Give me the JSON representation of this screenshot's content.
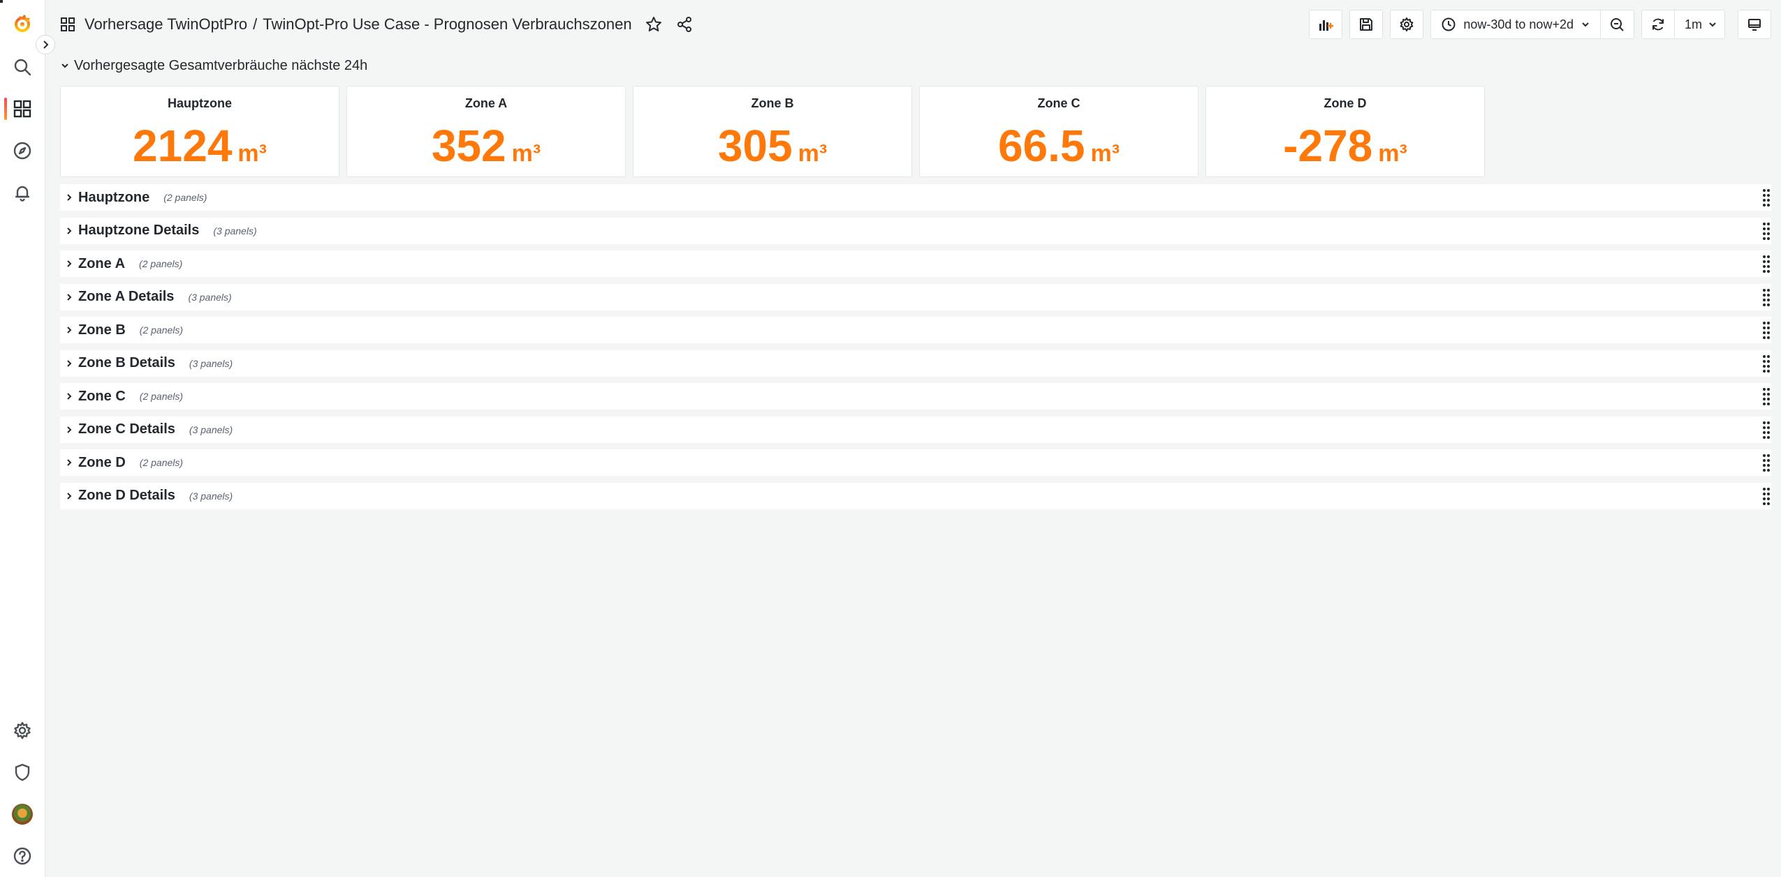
{
  "breadcrumb": {
    "folder": "Vorhersage TwinOptPro",
    "separator": "/",
    "dashboard": "TwinOpt-Pro Use Case - Prognosen Verbrauchszonen"
  },
  "toolbar": {
    "time_range": "now-30d to now+2d",
    "refresh_interval": "1m"
  },
  "stat_row": {
    "title": "Vorhergesagte Gesamtverbräuche nächste 24h",
    "panels": [
      {
        "title": "Hauptzone",
        "value": "2124",
        "unit": "m³"
      },
      {
        "title": "Zone A",
        "value": "352",
        "unit": "m³"
      },
      {
        "title": "Zone B",
        "value": "305",
        "unit": "m³"
      },
      {
        "title": "Zone C",
        "value": "66.5",
        "unit": "m³"
      },
      {
        "title": "Zone D",
        "value": "-278",
        "unit": "m³"
      }
    ]
  },
  "rows": [
    {
      "name": "Hauptzone",
      "count": "(2 panels)"
    },
    {
      "name": "Hauptzone Details",
      "count": "(3 panels)"
    },
    {
      "name": "Zone A",
      "count": "(2 panels)"
    },
    {
      "name": "Zone A Details",
      "count": "(3 panels)"
    },
    {
      "name": "Zone B",
      "count": "(2 panels)"
    },
    {
      "name": "Zone B Details",
      "count": "(3 panels)"
    },
    {
      "name": "Zone C",
      "count": "(2 panels)"
    },
    {
      "name": "Zone C Details",
      "count": "(3 panels)"
    },
    {
      "name": "Zone D",
      "count": "(2 panels)"
    },
    {
      "name": "Zone D Details",
      "count": "(3 panels)"
    }
  ],
  "colors": {
    "accent": "#ff780a",
    "background": "#f4f5f5",
    "panel": "#ffffff",
    "text": "#24292e"
  },
  "icons": {
    "sidebar": [
      "grafana-logo-icon",
      "search-icon",
      "dashboards-icon",
      "explore-icon",
      "alerting-icon",
      "configuration-icon",
      "server-admin-icon",
      "user-avatar",
      "help-icon"
    ],
    "toolbar": [
      "add-panel-icon",
      "save-icon",
      "settings-icon",
      "clock-icon",
      "zoom-out-icon",
      "refresh-icon",
      "tv-mode-icon"
    ]
  }
}
